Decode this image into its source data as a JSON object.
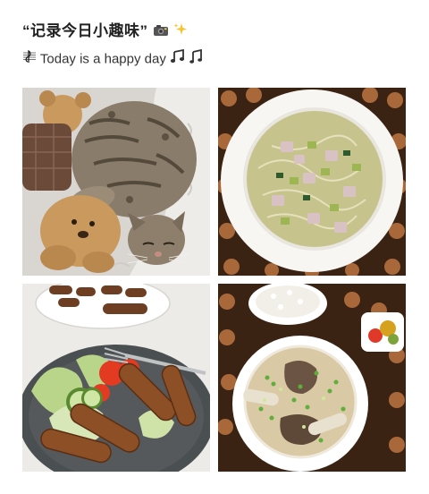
{
  "post": {
    "title": "“记录今日小趣味”",
    "title_emojis": [
      "camera-with-flash-icon",
      "sparkles-icon"
    ],
    "subtitle_prefix_icon": "musical-score-icon",
    "subtitle": "Today is a happy day",
    "subtitle_emojis": [
      "musical-notes-icon",
      "music-note-icon"
    ]
  },
  "photos": [
    {
      "id": "photo-cat-with-teddy-bear"
    },
    {
      "id": "photo-noodle-soup"
    },
    {
      "id": "photo-sausages-salad"
    },
    {
      "id": "photo-beef-bone-soup-rice"
    }
  ]
}
